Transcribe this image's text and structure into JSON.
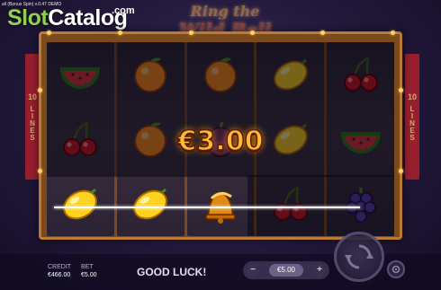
{
  "watermark": {
    "brand_a": "Slot",
    "brand_b": "Catalog",
    "suffix": ".com"
  },
  "version": "all (Bonus Spin) v.0.47 DEMO",
  "title": {
    "line1": "Ring the",
    "line2": "Wild Bell"
  },
  "lines_panel": {
    "count": "10",
    "label": "LINES"
  },
  "win_display": "€3.00",
  "reels": [
    [
      "watermelon",
      "cherry",
      "lemon"
    ],
    [
      "orange",
      "orange",
      "lemon"
    ],
    [
      "orange",
      "plum",
      "bell"
    ],
    [
      "lemon",
      "lemon",
      "cherry"
    ],
    [
      "cherry",
      "watermelon",
      "grapes"
    ]
  ],
  "status": {
    "credit_label": "CREDIT",
    "credit_value": "€466.00",
    "bet_label": "BET",
    "bet_value": "€5.00",
    "message": "GOOD LUCK!"
  },
  "bet_control": {
    "minus": "−",
    "plus": "+",
    "value": "€5.00"
  },
  "colors": {
    "win_text": "#ffb83a",
    "frame": "#7a4a1c",
    "accent": "#8fd14f"
  },
  "icons": {
    "spin": "spin-arrows-icon",
    "settings": "gear-icon",
    "wild_bell": "wild-bell-icon"
  }
}
